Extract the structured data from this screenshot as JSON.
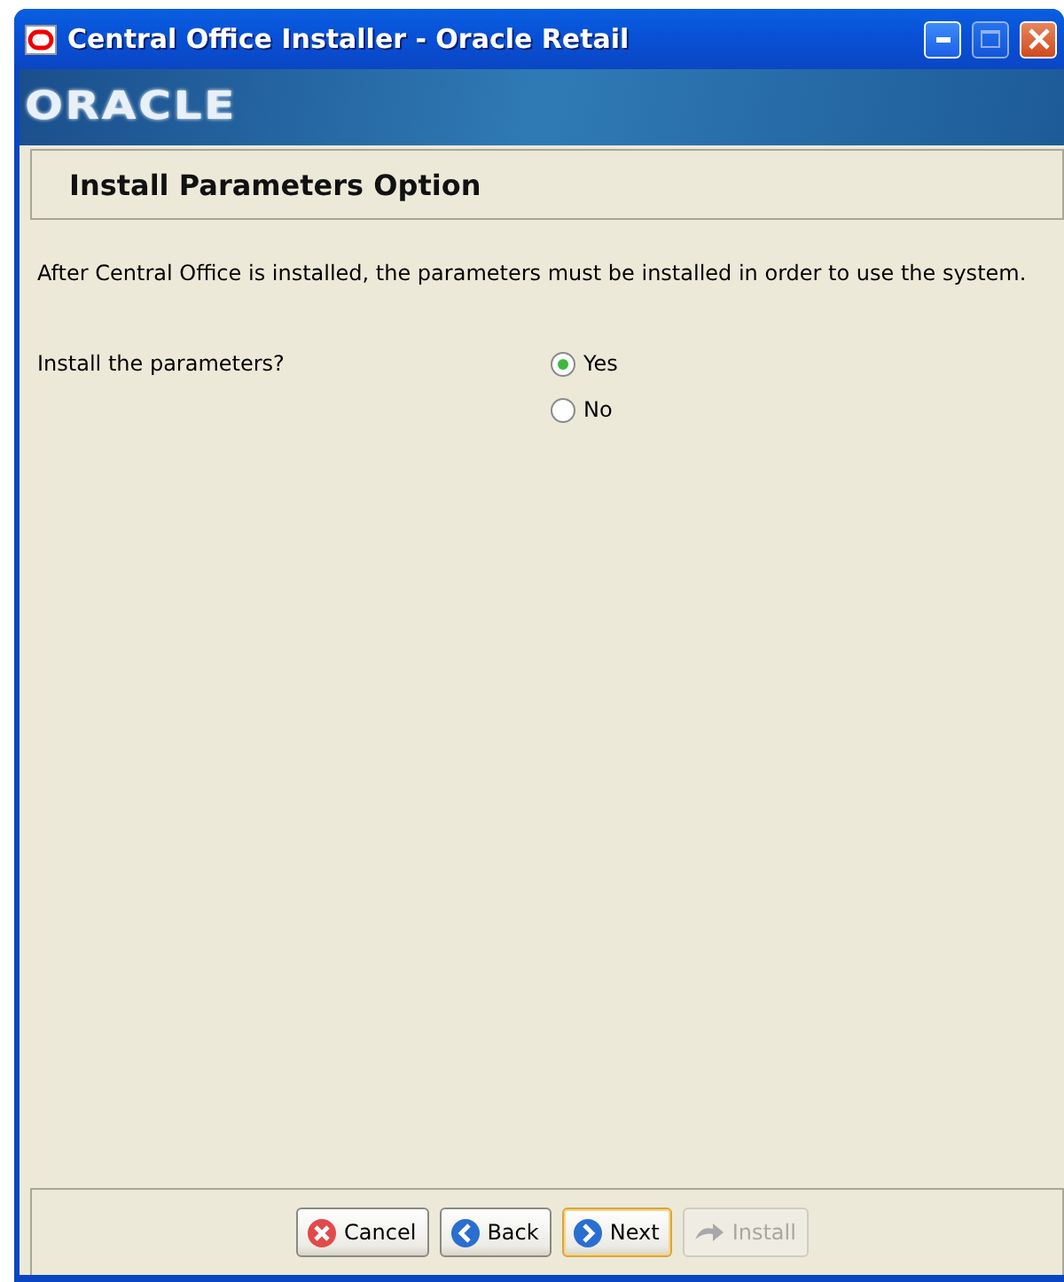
{
  "window": {
    "title": "Central Office Installer - Oracle Retail"
  },
  "banner": {
    "logo": "ORACLE"
  },
  "header": {
    "title": "Install Parameters Option"
  },
  "description": "After Central Office is installed, the parameters must be installed in order to use the system.",
  "question": {
    "label": "Install the parameters?",
    "options": [
      {
        "label": "Yes",
        "selected": true
      },
      {
        "label": "No",
        "selected": false
      }
    ]
  },
  "buttons": [
    {
      "label": "Cancel",
      "kind": "cancel",
      "disabled": false,
      "focused": false
    },
    {
      "label": "Back",
      "kind": "back",
      "disabled": false,
      "focused": false
    },
    {
      "label": "Next",
      "kind": "next",
      "disabled": false,
      "focused": true
    },
    {
      "label": "Install",
      "kind": "install",
      "disabled": true,
      "focused": false
    }
  ]
}
